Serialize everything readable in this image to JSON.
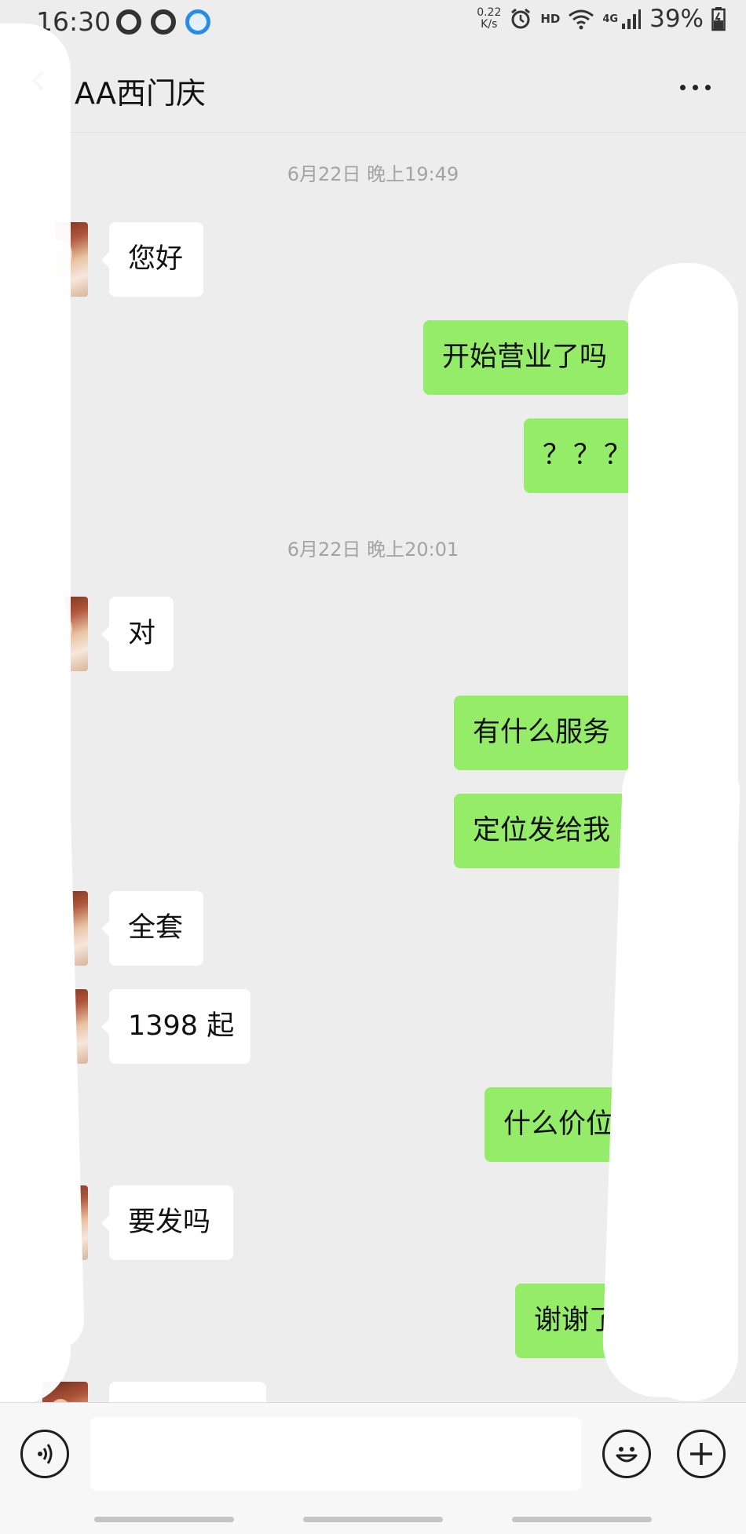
{
  "status_bar": {
    "time": "16:30",
    "net_speed_value": "0.22",
    "net_speed_unit": "K/s",
    "hd_label": "HD",
    "network_label": "4G",
    "battery": "39%",
    "app_icons": [
      "qq-icon",
      "qq-icon",
      "browser-icon"
    ]
  },
  "header": {
    "title": "AA西门庆"
  },
  "messages": {
    "ts1": "6月22日 晚上19:49",
    "m1": "您好",
    "m2": "开始营业了吗",
    "m3": "？？？",
    "ts2": "6月22日 晚上20:01",
    "m4": "对",
    "m5": "有什么服务",
    "m6": "定位发给我",
    "m7": "全套",
    "m8": "1398 起",
    "m9": "什么价位",
    "m10": "要发吗",
    "m11": "谢谢了",
    "m12": ""
  },
  "input": {
    "value": "",
    "placeholder": ""
  },
  "colors": {
    "background": "#ededed",
    "outgoing_bubble": "#95ec69",
    "incoming_bubble": "#ffffff"
  }
}
